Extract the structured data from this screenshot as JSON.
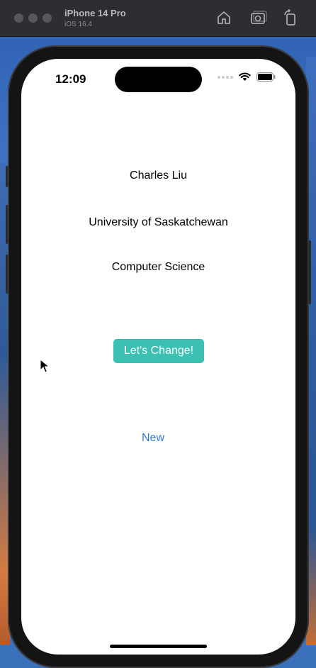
{
  "simulator": {
    "device_name": "iPhone 14 Pro",
    "os_version": "iOS 16.4",
    "icons": [
      "home-icon",
      "screenshot-icon",
      "rotate-icon"
    ]
  },
  "status_bar": {
    "time": "12:09",
    "icons": [
      "signal-dots-icon",
      "wifi-icon",
      "battery-icon"
    ]
  },
  "content": {
    "name": "Charles Liu",
    "university": "University of Saskatchewan",
    "department": "Computer Science",
    "change_button_label": "Let's Change!",
    "new_link_label": "New"
  },
  "colors": {
    "button_bg": "#3cc0b2",
    "button_text": "#ffffff",
    "link": "#2f7bd8",
    "screen_bg": "#ffffff"
  }
}
